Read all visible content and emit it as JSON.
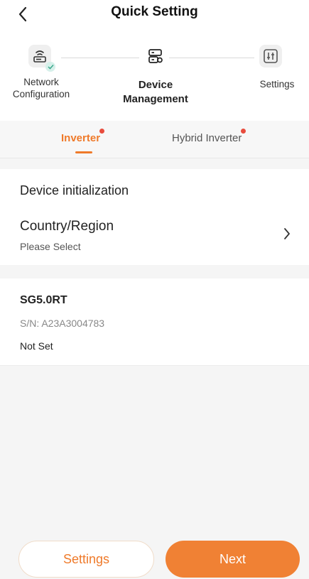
{
  "header": {
    "title": "Quick Setting",
    "back_icon": "chevron-left-icon"
  },
  "stepper": {
    "steps": [
      {
        "label_line1": "Network",
        "label_line2": "Configuration",
        "icon": "router-icon",
        "state": "completed"
      },
      {
        "label_line1": "Device",
        "label_line2": "Management",
        "icon": "device-icon",
        "state": "active"
      },
      {
        "label_line1": "Settings",
        "label_line2": "",
        "icon": "sliders-icon",
        "state": "pending"
      }
    ]
  },
  "tabs": [
    {
      "label": "Inverter",
      "selected": true,
      "has_dot": true
    },
    {
      "label": "Hybrid Inverter",
      "selected": false,
      "has_dot": true
    }
  ],
  "initialization": {
    "heading": "Device initialization",
    "country_label": "Country/Region",
    "country_value": "Please Select"
  },
  "device": {
    "model": "SG5.0RT",
    "serial": "S/N: A23A3004783",
    "status": "Not Set"
  },
  "footer": {
    "settings_label": "Settings",
    "next_label": "Next"
  },
  "colors": {
    "accent": "#ef7a2a",
    "next_button": "#f08134",
    "badge": "#e84c3d"
  }
}
